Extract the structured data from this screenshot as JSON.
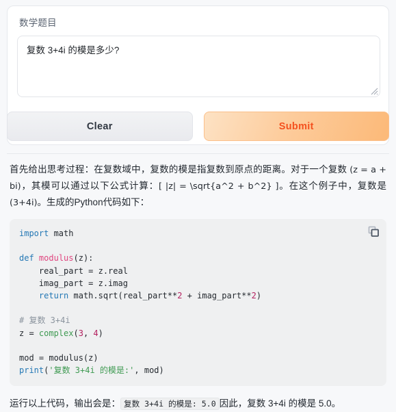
{
  "form": {
    "label": "数学题目",
    "textarea_value": "复数 3+4i 的模是多少?",
    "textarea_placeholder": "",
    "clear_label": "Clear",
    "submit_label": "Submit"
  },
  "theme": {
    "page_background": "#f7f8fa",
    "card_background": "#ffffff",
    "submit_text": "#f4511f",
    "submit_gradient_start": "#fde2c4",
    "submit_gradient_end": "#fcb978",
    "clear_background": "#eceef1",
    "code_background": "#eff0f1"
  },
  "response": {
    "paragraph_1_part_1": "首先给出思考过程：在复数域中，复数的模是指复数到原点的距离。对于一个复数 ",
    "paragraph_1_math_1": "(z = a + bi)",
    "paragraph_1_part_2": "，其模可以通过以下公式计算：",
    "paragraph_1_math_2": "[ |z| = \\sqrt{a^2 + b^2} ]",
    "paragraph_1_part_3": "。在这个例子中，复数是 ",
    "paragraph_1_math_3": "(3+4i)",
    "paragraph_1_part_4": "。生成的Python代码如下：",
    "code_copy_icon": "copy-icon",
    "closing_part_1": "运行以上代码，输出会是：",
    "closing_inline_code": "复数 3+4i 的模是: 5.0",
    "closing_part_2": "因此，复数 3+4i 的模是 5.0。"
  },
  "code": {
    "language": "python",
    "lines": [
      [
        {
          "t": "import",
          "c": "kw"
        },
        {
          "t": " math",
          "c": ""
        }
      ],
      [],
      [
        {
          "t": "def",
          "c": "kw"
        },
        {
          "t": " ",
          "c": ""
        },
        {
          "t": "modulus",
          "c": "fn"
        },
        {
          "t": "(z):",
          "c": ""
        }
      ],
      [
        {
          "t": "    real_part = z.real",
          "c": ""
        }
      ],
      [
        {
          "t": "    imag_part = z.imag",
          "c": ""
        }
      ],
      [
        {
          "t": "    ",
          "c": ""
        },
        {
          "t": "return",
          "c": "kw"
        },
        {
          "t": " math.sqrt(real_part**",
          "c": ""
        },
        {
          "t": "2",
          "c": "num"
        },
        {
          "t": " + imag_part**",
          "c": ""
        },
        {
          "t": "2",
          "c": "num"
        },
        {
          "t": ")",
          "c": ""
        }
      ],
      [],
      [
        {
          "t": "# 复数 3+4i",
          "c": "cmt"
        }
      ],
      [
        {
          "t": "z = ",
          "c": ""
        },
        {
          "t": "complex",
          "c": "bi"
        },
        {
          "t": "(",
          "c": ""
        },
        {
          "t": "3",
          "c": "num"
        },
        {
          "t": ", ",
          "c": ""
        },
        {
          "t": "4",
          "c": "num"
        },
        {
          "t": ")",
          "c": ""
        }
      ],
      [],
      [
        {
          "t": "mod = modulus(z)",
          "c": ""
        }
      ],
      [
        {
          "t": "print",
          "c": "kw"
        },
        {
          "t": "(",
          "c": ""
        },
        {
          "t": "'复数 3+4i 的模是:'",
          "c": "str"
        },
        {
          "t": ", mod)",
          "c": ""
        }
      ]
    ]
  }
}
